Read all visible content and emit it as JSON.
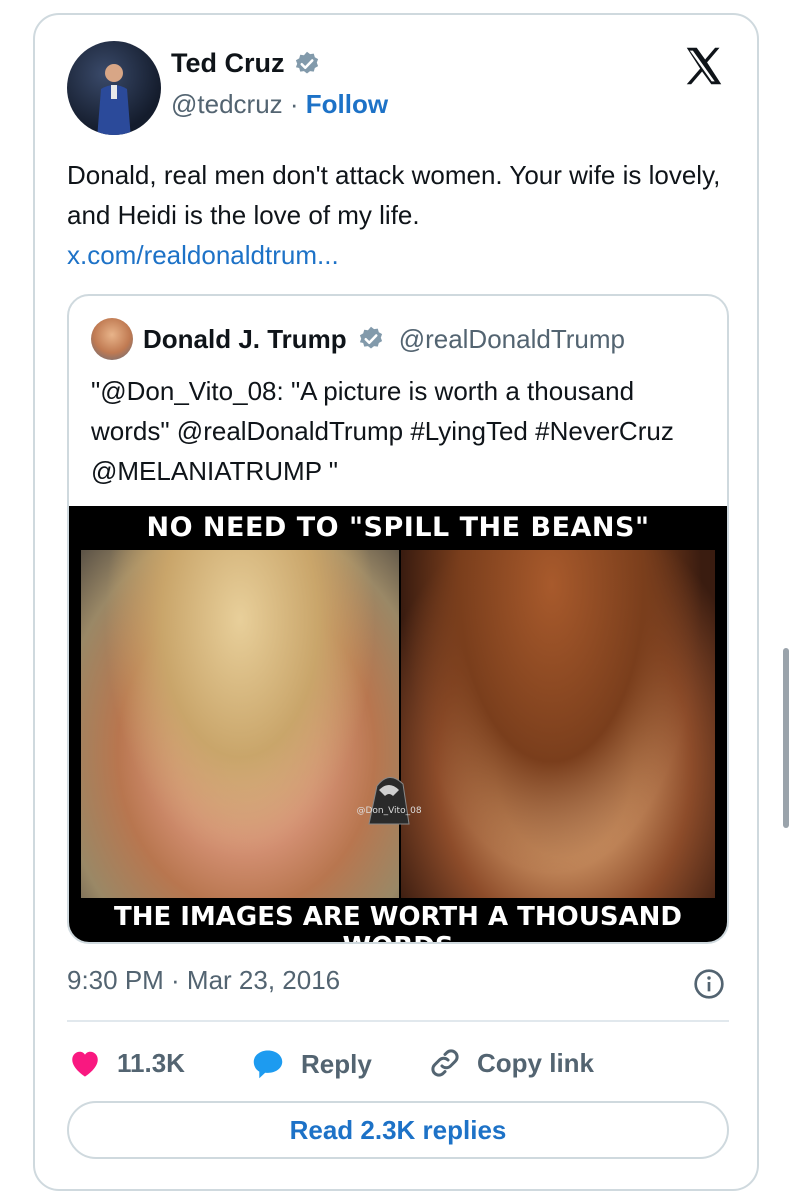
{
  "tweet": {
    "author_name": "Ted Cruz",
    "author_handle": "@tedcruz",
    "separator": "·",
    "follow_label": "Follow",
    "text": "Donald, real men don't attack women. Your wife is lovely, and Heidi is the love of my life.",
    "link_text": "x.com/realdonaldtrum...",
    "timestamp": "9:30 PM · Mar 23, 2016"
  },
  "quote": {
    "author_name": "Donald J. Trump",
    "author_handle": "@realDonaldTrump",
    "text": "\"@Don_Vito_08: \"A picture is worth a thousand words\" @realDonaldTrump #LyingTed #NeverCruz  @MELANIATRUMP \"",
    "meme": {
      "top_caption": "NO NEED TO \"SPILL THE BEANS\"",
      "bottom_caption": "THE IMAGES ARE WORTH A THOUSAND WORDS",
      "watermark": "@Don_Vito_08"
    }
  },
  "actions": {
    "like_count": "11.3K",
    "reply_label": "Reply",
    "copy_label": "Copy link"
  },
  "read_replies_label": "Read 2.3K replies",
  "colors": {
    "link_blue": "#1d72c7",
    "verified_blue": "#829aab",
    "like_pink": "#f91880",
    "reply_blue": "#1d9bf0",
    "muted_gray": "#536471"
  },
  "icons": {
    "verified": "verified-badge-icon",
    "x_logo": "x-logo-icon",
    "info": "info-icon",
    "like": "heart-icon",
    "reply": "speech-bubble-icon",
    "copy": "link-icon"
  }
}
